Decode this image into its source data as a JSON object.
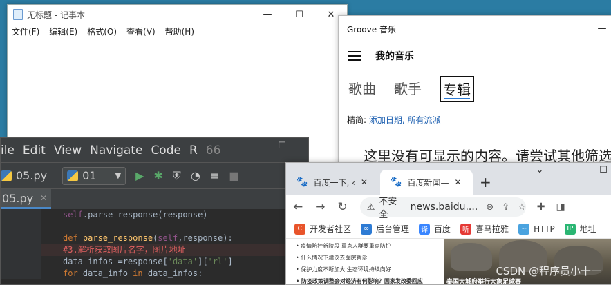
{
  "notepad": {
    "title": "无标题 - 记事本",
    "menu": [
      "文件(F)",
      "编辑(E)",
      "格式(O)",
      "查看(V)",
      "帮助(H)"
    ]
  },
  "groove": {
    "title": "Groove 音乐",
    "header": "我的音乐",
    "tabs": [
      "歌曲",
      "歌手",
      "专辑"
    ],
    "filter_label": "精简:",
    "filter_links": "添加日期, 所有流派",
    "empty_text": "这里没有可显示的内容。请尝试其他筛选"
  },
  "pycharm": {
    "menu": [
      "ile",
      "Edit",
      "View",
      "Navigate",
      "Code",
      "R",
      "66"
    ],
    "file": "05.py",
    "run_config": "01",
    "tab": "05.py",
    "code": [
      {
        "parts": [
          [
            "sf",
            "self"
          ],
          [
            "",
            "."
          ],
          [
            "",
            "parse_response(response)"
          ]
        ]
      },
      {
        "parts": [
          [
            "",
            ""
          ]
        ]
      },
      {
        "parts": [
          [
            "kw",
            "def "
          ],
          [
            "fn",
            "parse_response"
          ],
          [
            "",
            "("
          ],
          [
            "sf",
            "self"
          ],
          [
            "",
            ","
          ],
          [
            "",
            "response):"
          ]
        ]
      },
      {
        "parts": [
          [
            "red",
            "#3.解析获取图片名字，图片地址"
          ]
        ],
        "hl": true
      },
      {
        "parts": [
          [
            "",
            "data_infos ="
          ],
          [
            "",
            "response["
          ],
          [
            "st",
            "'data'"
          ],
          [
            "",
            "]["
          ],
          [
            "st",
            "'rl'"
          ],
          [
            "",
            "]"
          ]
        ]
      },
      {
        "parts": [
          [
            "kw",
            "for "
          ],
          [
            "",
            "data_info "
          ],
          [
            "kw",
            "in "
          ],
          [
            "",
            "data_infos:"
          ]
        ]
      }
    ]
  },
  "chrome": {
    "tabs": [
      "百度一下, ‹",
      "百度新闻—"
    ],
    "security": "不安全",
    "url": "news.baidu....",
    "bookmarks": [
      {
        "label": "开发者社区",
        "color": "#e8542b",
        "glyph": "C"
      },
      {
        "label": "后台管理",
        "color": "#2d7bd4",
        "glyph": "∞"
      },
      {
        "label": "百度",
        "color": "#3a86ff",
        "glyph": "译"
      },
      {
        "label": "喜马拉雅",
        "color": "#e53935",
        "glyph": "听"
      },
      {
        "label": "HTTP",
        "color": "#4aa3df",
        "glyph": "∽"
      },
      {
        "label": "地址",
        "color": "#2bb673",
        "glyph": "IP"
      }
    ],
    "news": [
      "疫情防控新阶段 重点人群要重点防护",
      "什么情况下建议去医院就诊",
      "保护力度不断加大 生态环境持续向好",
      "防疫政策调整会对经济有何影响？国家发改委回应"
    ],
    "photo_caption": "泰国大城府举行大象足球赛"
  },
  "watermark": "CSDN @程序员小十一"
}
